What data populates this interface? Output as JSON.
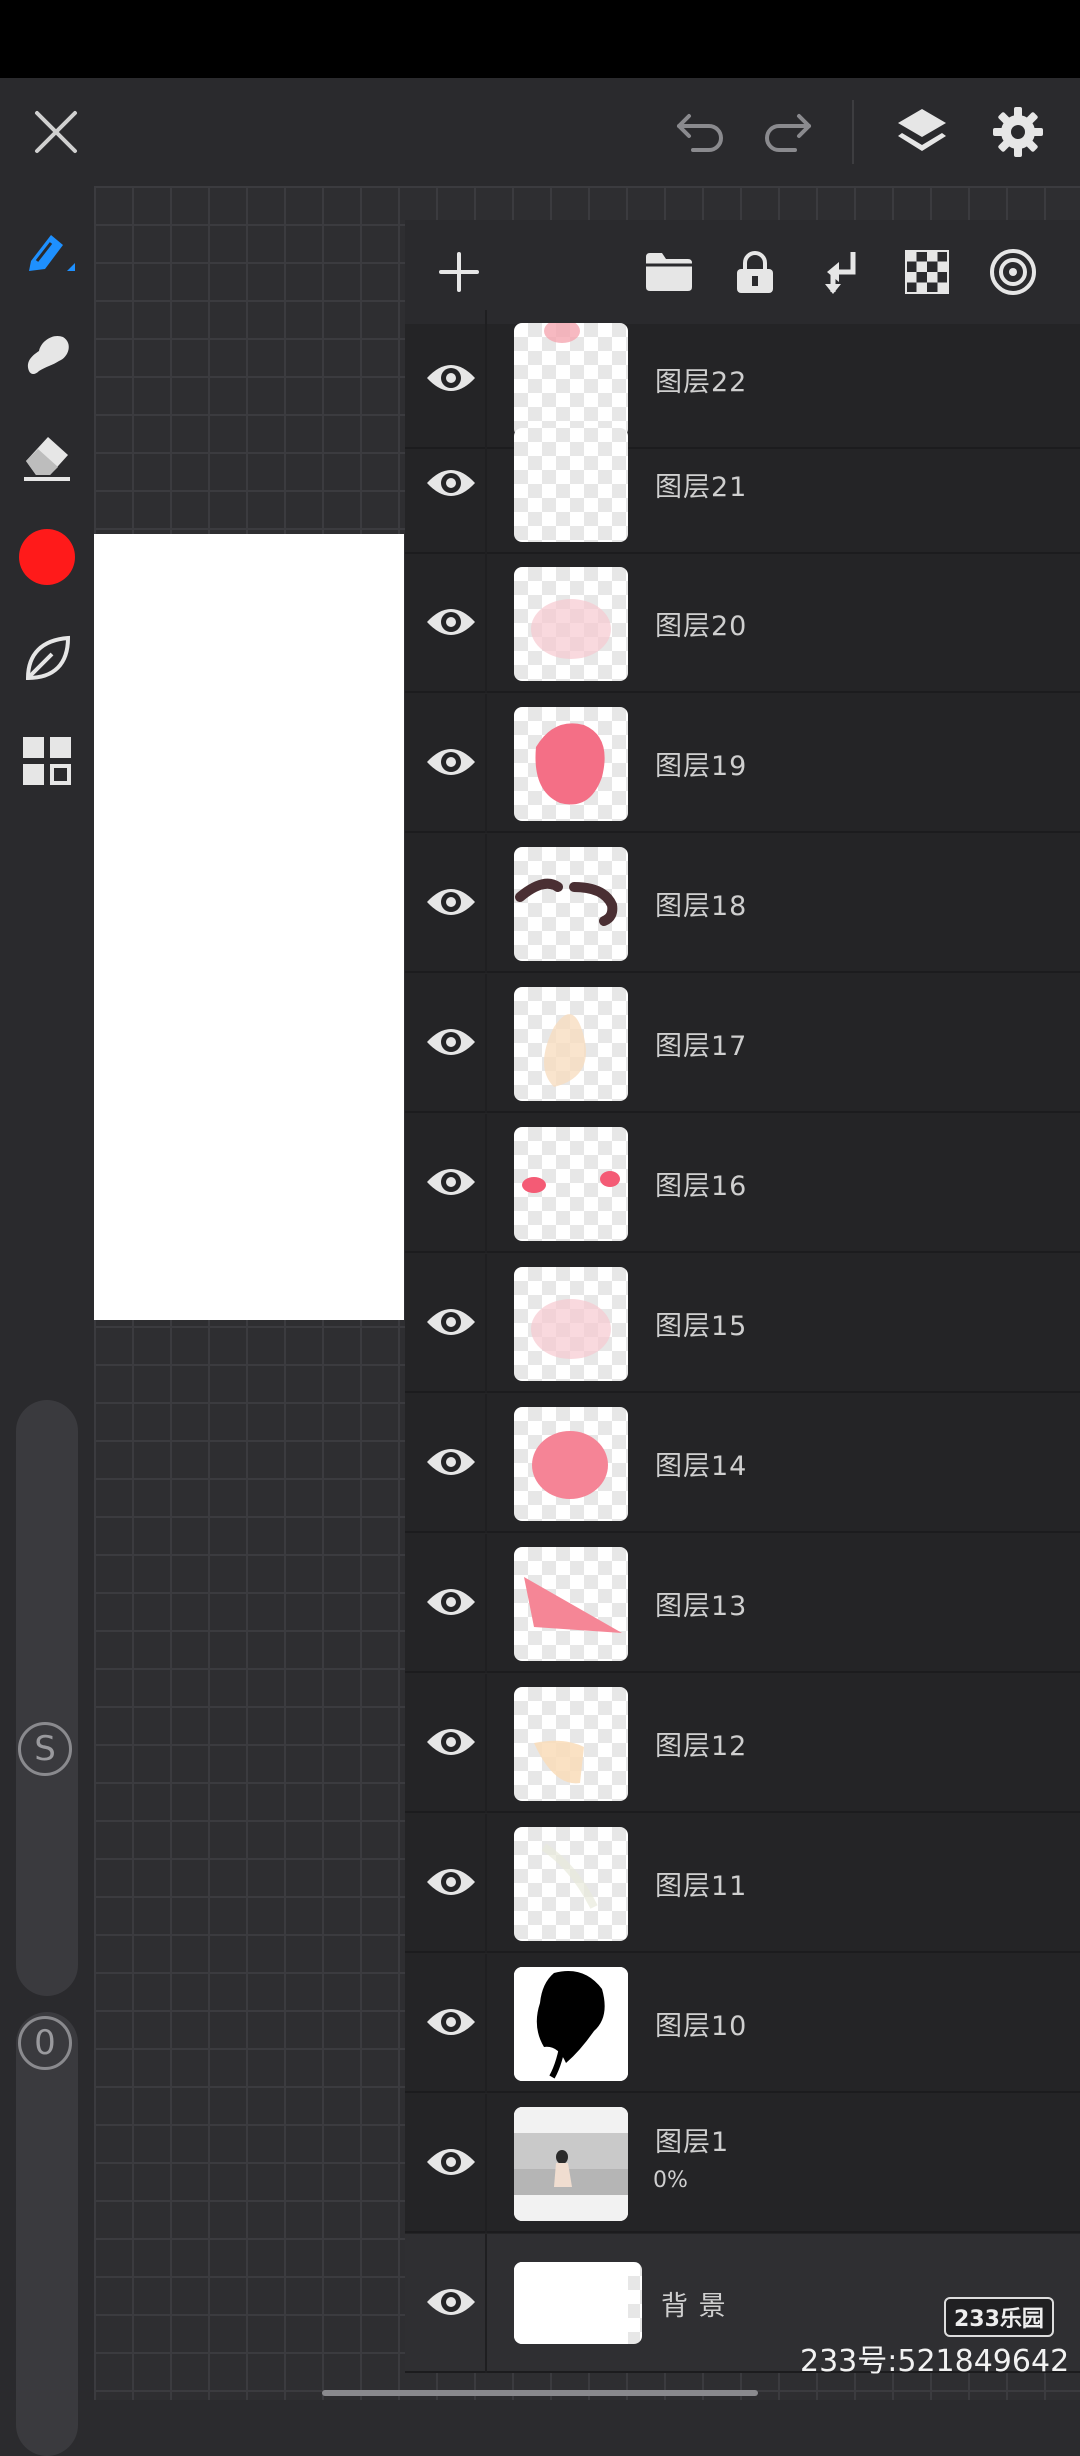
{
  "colors": {
    "accent": "#1e90ff",
    "current_color": "#ff1a1a",
    "panel_bg": "#242426",
    "toolbar_bg": "#2a2a2d"
  },
  "top_bar": {
    "close_icon": "close-icon",
    "undo_icon": "undo-icon",
    "redo_icon": "redo-icon",
    "layers_icon": "layers-icon",
    "settings_icon": "gear-icon"
  },
  "left_toolbar": {
    "tools": [
      "brush-pen-icon",
      "smudge-icon",
      "eraser-icon",
      "color-swatch",
      "leaf-shape-icon",
      "grid-panels-icon"
    ],
    "size_slider_label": "S",
    "opacity_slider_label": "0"
  },
  "layers_toolbar": {
    "icons": [
      "add-icon",
      "folder-icon",
      "lock-icon",
      "merge-down-icon",
      "transparency-checker-icon",
      "blend-target-icon"
    ]
  },
  "layers": [
    {
      "name": "图层22",
      "thumb": "pink-top"
    },
    {
      "name": "图层21",
      "thumb": "empty"
    },
    {
      "name": "图层20",
      "thumb": "pink-faint"
    },
    {
      "name": "图层19",
      "thumb": "pink-blob"
    },
    {
      "name": "图层18",
      "thumb": "dark-strokes"
    },
    {
      "name": "图层17",
      "thumb": "skin-faint"
    },
    {
      "name": "图层16",
      "thumb": "pink-dots"
    },
    {
      "name": "图层15",
      "thumb": "pink-faint"
    },
    {
      "name": "图层14",
      "thumb": "pink-blob2"
    },
    {
      "name": "图层13",
      "thumb": "pink-tri"
    },
    {
      "name": "图层12",
      "thumb": "skin-shape"
    },
    {
      "name": "图层11",
      "thumb": "empty-faint"
    },
    {
      "name": "图层10",
      "thumb": "black-hair"
    },
    {
      "name": "图层1",
      "thumb": "photo",
      "opacity": "0%"
    },
    {
      "name": "背 景",
      "thumb": "white"
    }
  ],
  "watermark": {
    "logo": "233乐园",
    "id": "233号:521849642"
  }
}
